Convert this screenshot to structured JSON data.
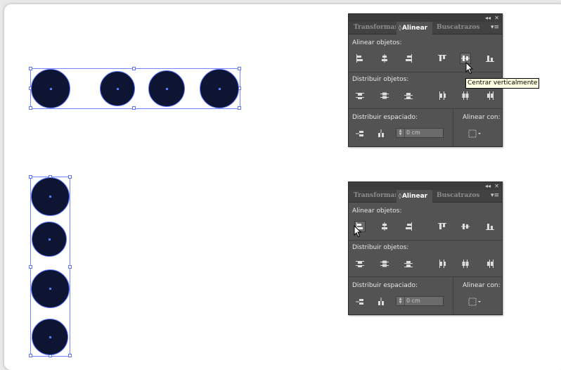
{
  "panel_top": {
    "controls": {
      "collapse": "◂◂",
      "close": "✕"
    },
    "tabs": {
      "transform": "Transformar",
      "align": "Alinear",
      "pathfinder": "Buscatrazos",
      "chevron": "◊",
      "menu": "▾≡"
    },
    "align_objects_label": "Alinear objetos:",
    "distribute_objects_label": "Distribuir objetos:",
    "distribute_spacing_label": "Distribuir espaciado:",
    "align_to_label": "Alinear con:",
    "spacing_value": "0 cm",
    "tooltip": "Centrar verticalmente",
    "pressed_button": "vertical-align-center"
  },
  "panel_bottom": {
    "controls": {
      "collapse": "◂◂",
      "close": "✕"
    },
    "tabs": {
      "transform": "Transformar",
      "align": "Alinear",
      "pathfinder": "Buscatrazos",
      "chevron": "◊",
      "menu": "▾≡"
    },
    "align_objects_label": "Alinear objetos:",
    "distribute_objects_label": "Distribuir objetos:",
    "distribute_spacing_label": "Distribuir espaciado:",
    "align_to_label": "Alinear con:",
    "spacing_value": "0 cm",
    "pressed_button": "horizontal-align-left"
  },
  "colors": {
    "shape_fill": "#0d1533",
    "selection": "#5c73ff",
    "panel_bg": "#535353",
    "tooltip_bg": "#ffffe1"
  }
}
